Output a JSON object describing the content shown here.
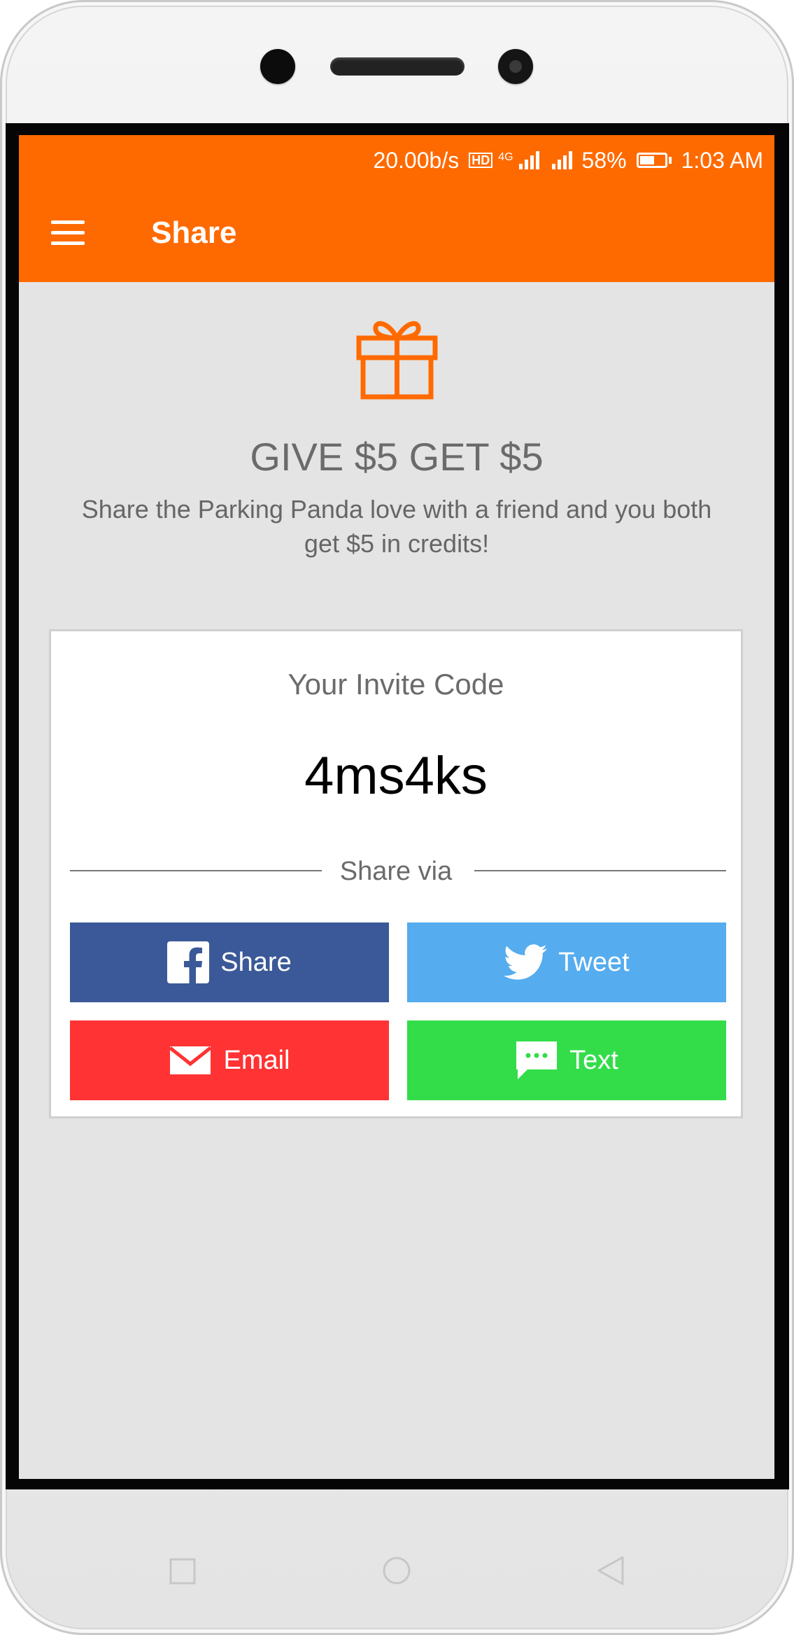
{
  "status_bar": {
    "speed": "20.00b/s",
    "network": "4G",
    "hd_label": "HD",
    "battery": "58%",
    "battery_level": 0.58,
    "time": "1:03 AM"
  },
  "app_bar": {
    "menu_icon": "hamburger-menu-icon",
    "title": "Share"
  },
  "promo": {
    "icon": "gift-icon",
    "headline": "GIVE $5 GET $5",
    "description": "Share the Parking Panda love with a friend and you both get $5 in credits!"
  },
  "invite": {
    "label": "Your Invite Code",
    "code": "4ms4ks",
    "share_via": "Share via"
  },
  "share_buttons": {
    "facebook": {
      "label": "Share",
      "icon": "facebook-icon",
      "color": "#3b5998"
    },
    "twitter": {
      "label": "Tweet",
      "icon": "twitter-bird-icon",
      "color": "#55acee"
    },
    "email": {
      "label": "Email",
      "icon": "envelope-icon",
      "color": "#ff3333"
    },
    "text": {
      "label": "Text",
      "icon": "sms-bubble-icon",
      "color": "#33dd4a"
    }
  },
  "colors": {
    "accent": "#ff6a00",
    "background": "#e4e4e4"
  },
  "nav_bar": {
    "recents_icon": "square-recents-icon",
    "home_icon": "circle-home-icon",
    "back_icon": "triangle-back-icon"
  }
}
